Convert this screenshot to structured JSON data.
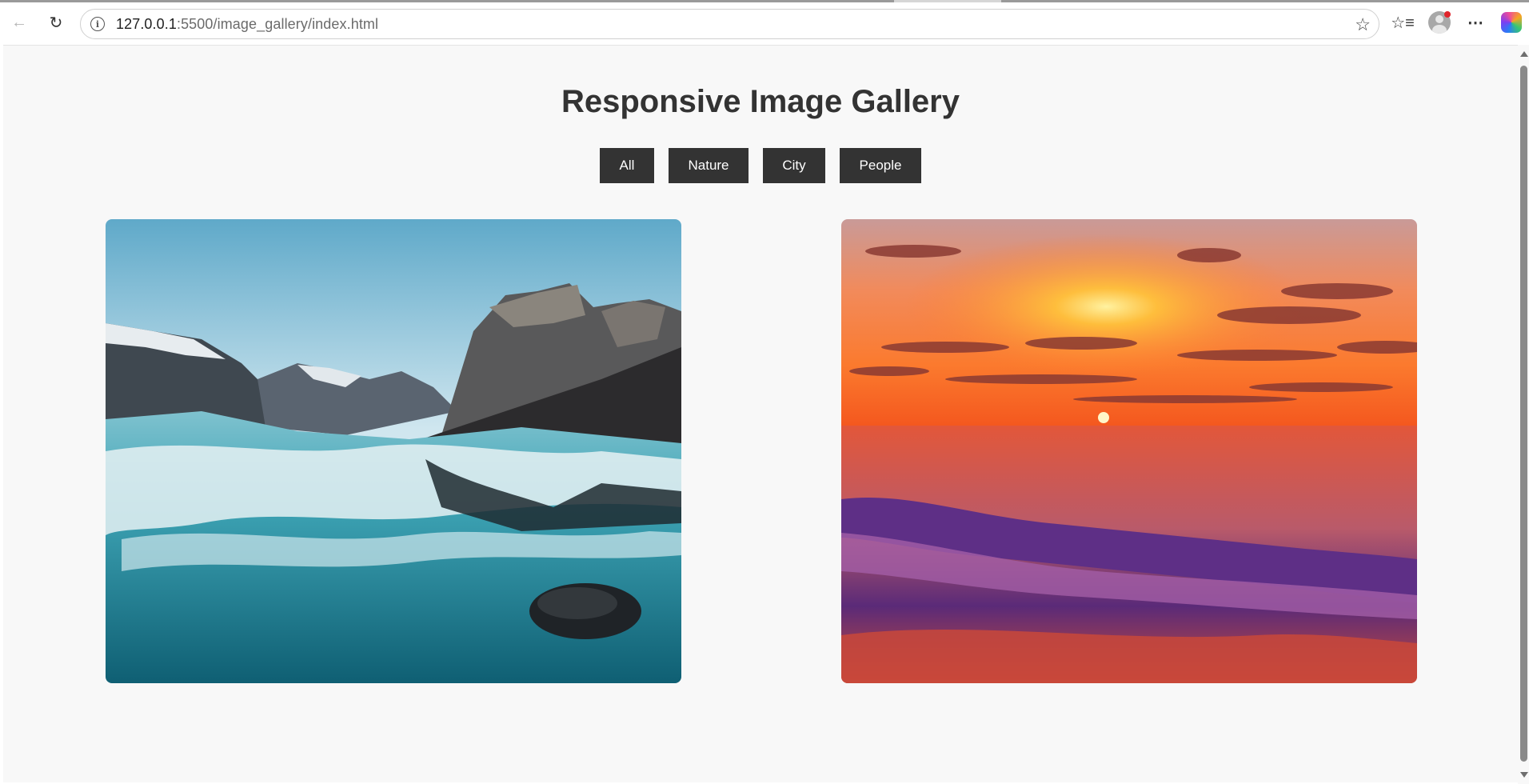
{
  "browser": {
    "url_host": "127.0.0.1",
    "url_rest": ":5500/image_gallery/index.html",
    "icons": [
      "back-arrow-icon",
      "reload-icon",
      "info-icon",
      "star-icon",
      "favorites-icon",
      "profile-icon",
      "more-icon",
      "copilot-icon"
    ]
  },
  "page": {
    "title": "Responsive Image Gallery",
    "filters": [
      {
        "label": "All"
      },
      {
        "label": "Nature"
      },
      {
        "label": "City"
      },
      {
        "label": "People"
      }
    ],
    "gallery": [
      {
        "subject": "mountain river"
      },
      {
        "subject": "ocean sunset"
      }
    ]
  },
  "colors": {
    "button_bg": "#333333",
    "button_text": "#ffffff",
    "title": "#333333",
    "page_bg": "#f8f8f8"
  }
}
